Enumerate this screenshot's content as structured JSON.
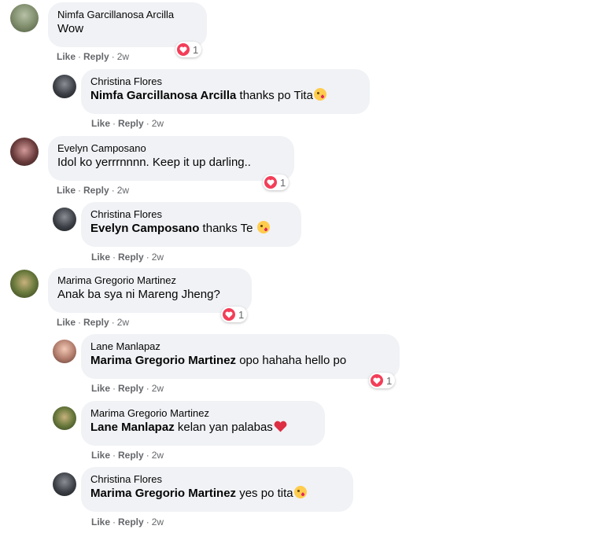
{
  "actions": {
    "like": "Like",
    "reply": "Reply",
    "time": "2w",
    "dot": "·"
  },
  "comments": [
    {
      "author": "Nimfa Garcillanosa Arcilla",
      "mention": "",
      "text": "Wow",
      "reactions": "1"
    },
    {
      "author": "Christina Flores",
      "mention": "Nimfa Garcillanosa Arcilla",
      "text": " thanks po Tita"
    },
    {
      "author": "Evelyn Camposano",
      "mention": "",
      "text": "Idol ko yerrrnnnn. Keep it up darling..",
      "reactions": "1"
    },
    {
      "author": "Christina Flores",
      "mention": "Evelyn Camposano",
      "text": " thanks Te "
    },
    {
      "author": "Marima Gregorio Martinez",
      "mention": "",
      "text": "Anak ba sya ni Mareng Jheng?",
      "reactions": "1"
    },
    {
      "author": "Lane Manlapaz",
      "mention": "Marima Gregorio Martinez",
      "text": " opo hahaha hello po",
      "reactions": "1"
    },
    {
      "author": "Marima Gregorio Martinez",
      "mention": "Lane Manlapaz",
      "text": " kelan yan palabas"
    },
    {
      "author": "Christina Flores",
      "mention": "Marima Gregorio Martinez",
      "text": " yes po tita"
    }
  ],
  "colors": {
    "bubble": "#f0f2f5",
    "meta": "#65676b",
    "heart": "#f33e58"
  },
  "icons": {
    "reaction": "heart-icon",
    "kiss": "kissing-face-emoji",
    "red_heart": "red-heart-emoji"
  }
}
